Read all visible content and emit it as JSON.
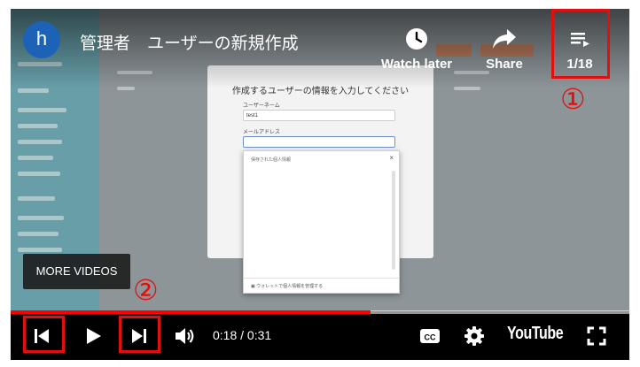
{
  "header": {
    "channel_initial": "h",
    "video_title": "管理者　ユーザーの新規作成",
    "watch_later_label": "Watch later",
    "share_label": "Share",
    "playlist_position": "1/18"
  },
  "video_content": {
    "dialog_title": "作成するユーザーの情報を入力してください",
    "username_label": "ユーザーネーム",
    "username_value": "test1",
    "email_label": "メールアドレス",
    "autofill_title": "保存された個人情報",
    "autofill_close": "×",
    "autofill_footer": "ウォレットで個人情報を管理する"
  },
  "more_videos_label": "MORE VIDEOS",
  "player": {
    "current_time": "0:18",
    "duration": "0:31",
    "time_display": "0:18 / 0:31",
    "progress_fraction": 0.581,
    "logo_text": "YouTube"
  },
  "annotations": {
    "marker_1": "①",
    "marker_2": "②",
    "color": "#e01010"
  },
  "colors": {
    "progress": "#ff0000",
    "channel_logo": "#1c63b8"
  }
}
